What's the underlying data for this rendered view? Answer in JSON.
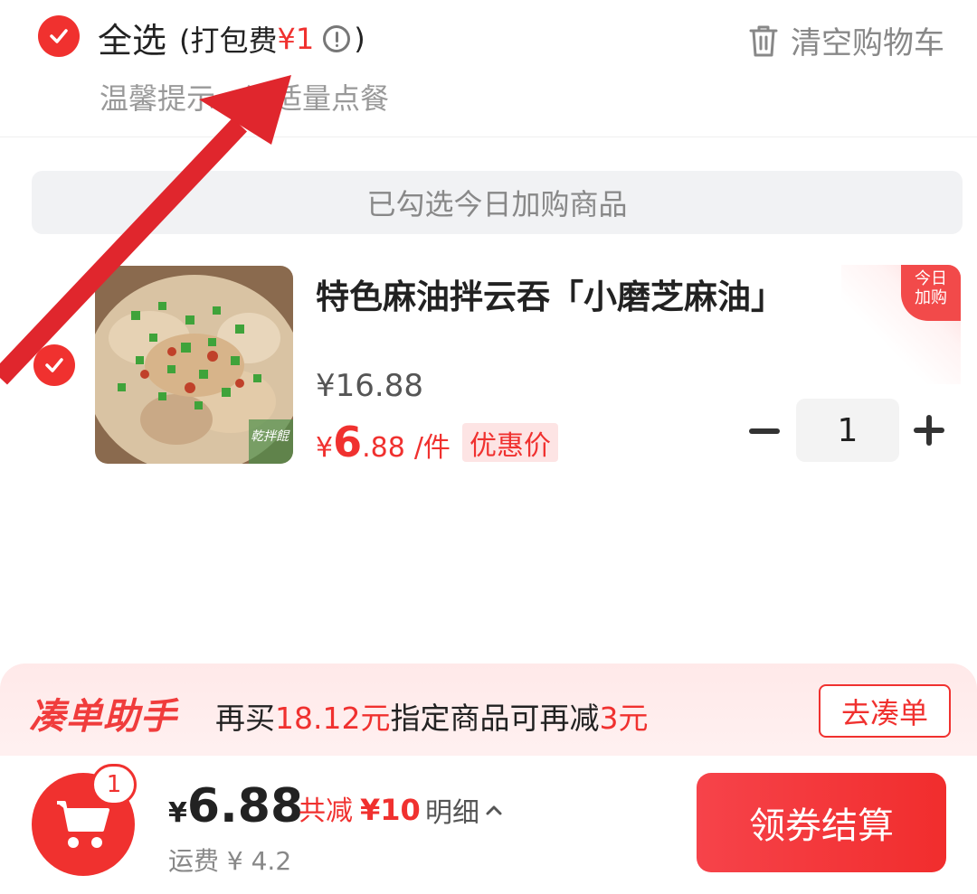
{
  "header": {
    "select_all_label": "全选",
    "pack_fee_open": "(打包费",
    "pack_fee_amount": "¥1",
    "pack_fee_close": ")",
    "clear_cart_label": "清空购物车",
    "hint": "温馨提示，请适量点餐"
  },
  "today_banner": "已勾选今日加购商品",
  "product": {
    "name": "特色麻油拌云吞「小磨芝麻油」",
    "corner_badge_line1": "今日",
    "corner_badge_line2": "加购",
    "original_price": "¥16.88",
    "sale_symbol": "¥",
    "sale_int": "6",
    "sale_dec": ".88",
    "sale_unit": "/件",
    "sale_tag": "优惠价",
    "quantity": "1",
    "image_caption": "乾拌餛"
  },
  "promo": {
    "title": "凑单助手",
    "text_1": "再买",
    "text_amount": "18.12元",
    "text_2": "指定商品可再减",
    "text_reduce": "3元",
    "button": "去凑单"
  },
  "bottom": {
    "cart_count": "1",
    "total_symbol": "¥",
    "total": "6.88",
    "discount_label": "共减",
    "discount_amount": "¥10",
    "detail_label": "明细",
    "shipping": "运费 ¥ 4.2",
    "checkout_label": "领券结算"
  },
  "colors": {
    "accent": "#f0312f",
    "promo_bg": "#ffe9e9"
  }
}
